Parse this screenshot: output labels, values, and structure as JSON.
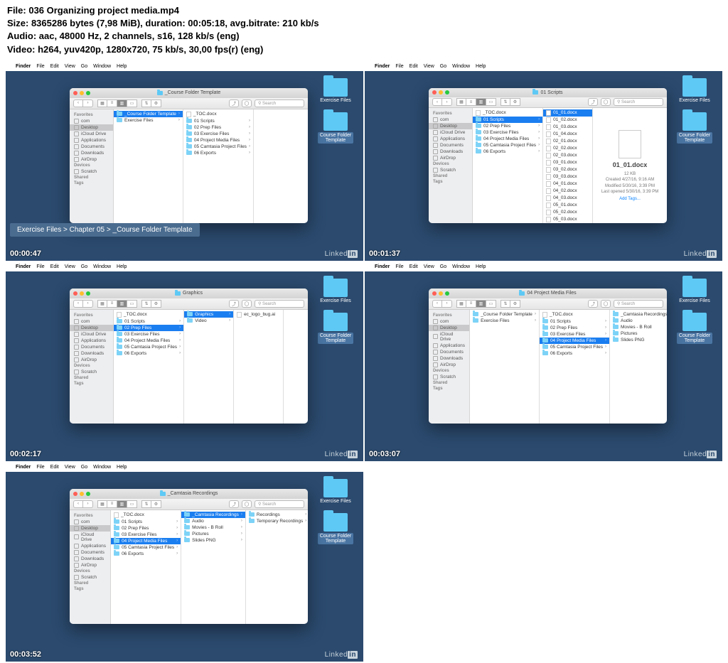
{
  "meta": {
    "line1": "File: 036 Organizing project media.mp4",
    "line2": "Size: 8365286 bytes (7,98 MiB), duration: 00:05:18, avg.bitrate: 210 kb/s",
    "line3": "Audio: aac, 48000 Hz, 2 channels, s16, 128 kb/s (eng)",
    "line4": "Video: h264, yuv420p, 1280x720, 75 kb/s, 30,00 fps(r) (eng)"
  },
  "menubar": {
    "app": "Finder",
    "items": [
      "File",
      "Edit",
      "View",
      "Go",
      "Window",
      "Help"
    ]
  },
  "desktop_icons": {
    "exercise": "Exercise Files",
    "template": "Course Folder Template"
  },
  "sidebar": {
    "favorites": "Favorites",
    "items": [
      "com",
      "Desktop",
      "iCloud Drive",
      "Applications",
      "Documents",
      "Downloads",
      "AirDrop"
    ],
    "devices": "Devices",
    "device_items": [
      "Scratch"
    ],
    "shared": "Shared",
    "tags": "Tags"
  },
  "toolbar": {
    "search_placeholder": "Search"
  },
  "linkedin": "Linked",
  "linkedin_in": "in",
  "frames": [
    {
      "timestamp": "00:00:47",
      "title": "_Course Folder Template",
      "breadcrumb": "Exercise Files > Chapter 05 > _Course Folder Template",
      "col1": [
        {
          "t": "_Course Folder Template",
          "sel": true,
          "f": true
        },
        {
          "t": "Exercise Files",
          "f": true
        }
      ],
      "col2": [
        {
          "t": "_TOC.docx",
          "d": true
        },
        {
          "t": "01 Scripts",
          "f": true
        },
        {
          "t": "02 Prep Files",
          "f": true
        },
        {
          "t": "03 Exercise Files",
          "f": true
        },
        {
          "t": "04 Project Media Files",
          "f": true
        },
        {
          "t": "05 Camtasia Project Files",
          "f": true
        },
        {
          "t": "06 Exports",
          "f": true
        }
      ]
    },
    {
      "timestamp": "00:01:37",
      "title": "01 Scripts",
      "col1": [
        {
          "t": "_TOC.docx",
          "d": true
        },
        {
          "t": "01 Scripts",
          "sel": true,
          "f": true
        },
        {
          "t": "02 Prep Files",
          "f": true
        },
        {
          "t": "03 Exercise Files",
          "f": true
        },
        {
          "t": "04 Project Media Files",
          "f": true
        },
        {
          "t": "05 Camtasia Project Files",
          "f": true
        },
        {
          "t": "06 Exports",
          "f": true
        }
      ],
      "col2": [
        {
          "t": "01_01.docx",
          "sel": true,
          "d": true
        },
        {
          "t": "01_02.docx",
          "d": true
        },
        {
          "t": "01_03.docx",
          "d": true
        },
        {
          "t": "01_04.docx",
          "d": true
        },
        {
          "t": "02_01.docx",
          "d": true
        },
        {
          "t": "02_02.docx",
          "d": true
        },
        {
          "t": "02_03.docx",
          "d": true
        },
        {
          "t": "03_01.docx",
          "d": true
        },
        {
          "t": "03_02.docx",
          "d": true
        },
        {
          "t": "03_03.docx",
          "d": true
        },
        {
          "t": "04_01.docx",
          "d": true
        },
        {
          "t": "04_02.docx",
          "d": true
        },
        {
          "t": "04_03.docx",
          "d": true
        },
        {
          "t": "05_01.docx",
          "d": true
        },
        {
          "t": "05_02.docx",
          "d": true
        },
        {
          "t": "05_03.docx",
          "d": true
        }
      ],
      "preview": {
        "name": "01_01.docx",
        "size": "12 KB",
        "created": "Created  4/27/16, 9:16 AM",
        "modified": "Modified  5/30/16, 3:39 PM",
        "opened": "Last opened  5/30/16, 3:39 PM",
        "addtags": "Add Tags..."
      }
    },
    {
      "timestamp": "00:02:17",
      "title": "Graphics",
      "col1": [
        {
          "t": "_TOC.docx",
          "d": true
        },
        {
          "t": "01 Scripts",
          "f": true
        },
        {
          "t": "02 Prep Files",
          "sel": true,
          "f": true
        },
        {
          "t": "03 Exercise Files",
          "f": true
        },
        {
          "t": "04 Project Media Files",
          "f": true
        },
        {
          "t": "05 Camtasia Project Files",
          "f": true
        },
        {
          "t": "06 Exports",
          "f": true
        }
      ],
      "col2": [
        {
          "t": "Graphics",
          "sel": true,
          "f": true
        },
        {
          "t": "Video",
          "f": true
        }
      ],
      "col3": [
        {
          "t": "ec_logo_bug.ai",
          "d": true
        }
      ]
    },
    {
      "timestamp": "00:03:07",
      "title": "04 Project Media Files",
      "col1": [
        {
          "t": "_Course Folder Template",
          "f": true
        },
        {
          "t": "Exercise Files",
          "f": true
        }
      ],
      "col2": [
        {
          "t": "_TOC.docx",
          "d": true
        },
        {
          "t": "01 Scripts",
          "f": true
        },
        {
          "t": "02 Prep Files",
          "f": true
        },
        {
          "t": "03 Exercise Files",
          "f": true
        },
        {
          "t": "04 Project Media Files",
          "sel": true,
          "f": true
        },
        {
          "t": "05 Camtasia Project Files",
          "f": true
        },
        {
          "t": "06 Exports",
          "f": true
        }
      ],
      "col3": [
        {
          "t": "_Camtasia Recordings",
          "f": true
        },
        {
          "t": "Audio",
          "f": true
        },
        {
          "t": "Movies - B Roll",
          "f": true
        },
        {
          "t": "Pictures",
          "f": true
        },
        {
          "t": "Slides PNG",
          "f": true
        }
      ]
    },
    {
      "timestamp": "00:03:52",
      "title": "_Camtasia Recordings",
      "col1": [
        {
          "t": "_TOC.docx",
          "d": true
        },
        {
          "t": "01 Scripts",
          "f": true
        },
        {
          "t": "02 Prep Files",
          "f": true
        },
        {
          "t": "03 Exercise Files",
          "f": true
        },
        {
          "t": "04 Project Media Files",
          "sel": true,
          "f": true
        },
        {
          "t": "05 Camtasia Project Files",
          "f": true
        },
        {
          "t": "06 Exports",
          "f": true
        }
      ],
      "col2": [
        {
          "t": "_Camtasia Recordings",
          "sel": true,
          "f": true
        },
        {
          "t": "Audio",
          "f": true
        },
        {
          "t": "Movies - B Roll",
          "f": true
        },
        {
          "t": "Pictures",
          "f": true
        },
        {
          "t": "Slides PNG",
          "f": true
        }
      ],
      "col3": [
        {
          "t": "Recordings",
          "f": true
        },
        {
          "t": "Temporary Recordings",
          "f": true
        }
      ]
    }
  ]
}
